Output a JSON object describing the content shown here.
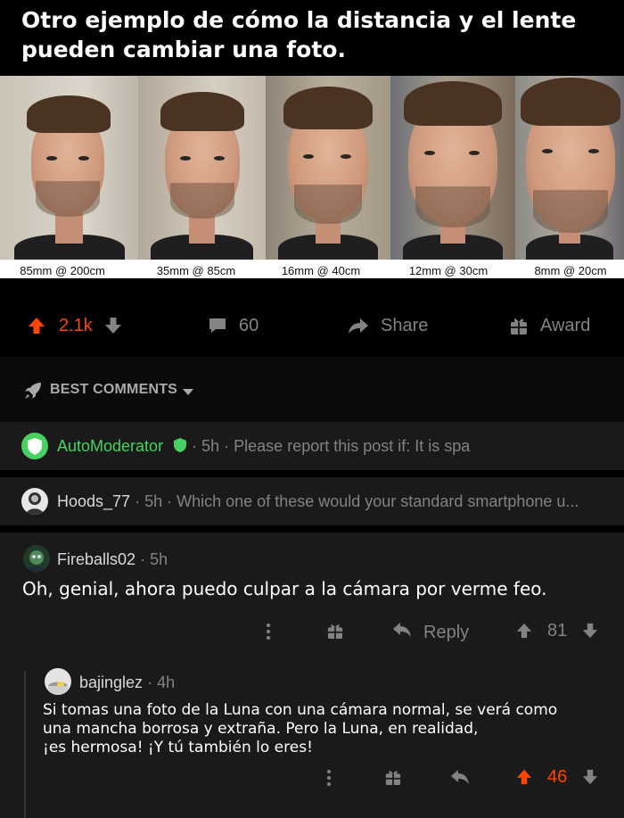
{
  "post": {
    "title": "Otro ejemplo de cómo la distancia y el lente pueden cambiar una foto.",
    "photos": [
      {
        "caption": "85mm @ 200cm"
      },
      {
        "caption": "35mm @ 85cm"
      },
      {
        "caption": "16mm @ 40cm"
      },
      {
        "caption": "12mm @ 30cm"
      },
      {
        "caption": "8mm @ 20cm"
      }
    ]
  },
  "actions": {
    "score": "2.1k",
    "comments": "60",
    "share_label": "Share",
    "award_label": "Award"
  },
  "best": {
    "label": "BEST COMMENTS"
  },
  "comments": {
    "mod": {
      "author": "AutoModerator",
      "time": "5h",
      "preview": "Please report this post if:  It is spa"
    },
    "hoods": {
      "author": "Hoods_77",
      "time": "5h",
      "preview": "Which one of these would your standard smartphone u..."
    },
    "fireballs": {
      "author": "Fireballs02",
      "time": "5h",
      "body": "Oh, genial, ahora puedo culpar a la cámara por verme feo.",
      "reply_label": "Reply",
      "score": "81"
    },
    "bajinglez": {
      "author": "bajinglez",
      "time": "4h",
      "body_line1": "Si tomas una foto de la Luna con una cámara normal, se verá como",
      "body_line2": "una mancha borrosa y extraña. Pero la Luna, en realidad,",
      "body_line3": "¡es hermosa! ¡Y tú también lo eres!",
      "score": "46"
    }
  },
  "colors": {
    "upvote": "#ff4500",
    "mod_green": "#46d160",
    "muted": "#818384",
    "row_bg": "#1a1a1b"
  }
}
